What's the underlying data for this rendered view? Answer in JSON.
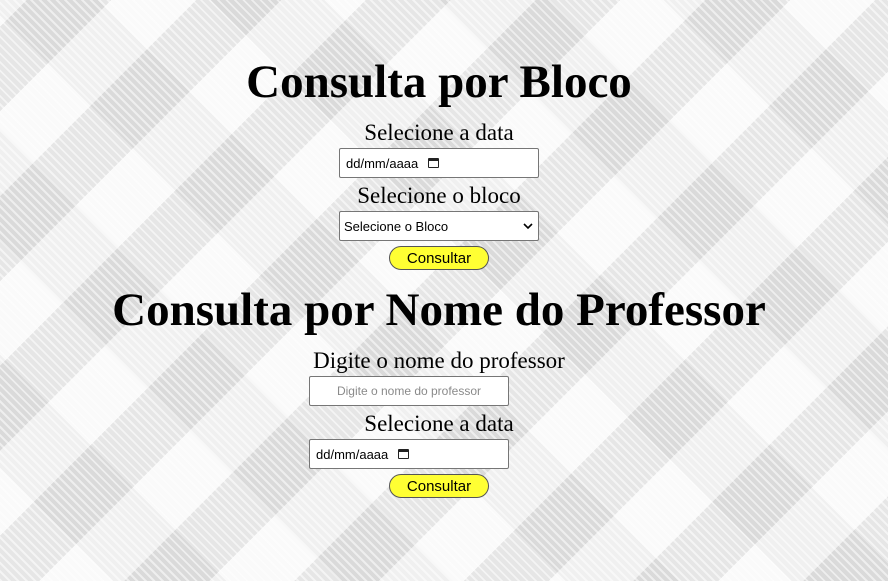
{
  "section_bloco": {
    "title": "Consulta por Bloco",
    "date_label": "Selecione a data",
    "date_value": "dd/mm/aaaa",
    "block_label": "Selecione o bloco",
    "block_selected": "Selecione o Bloco",
    "submit_label": "Consultar"
  },
  "section_professor": {
    "title": "Consulta por Nome do Professor",
    "name_label": "Digite o nome do professor",
    "name_placeholder": "Digite o nome do professor",
    "date_label": "Selecione a data",
    "date_value": "dd/mm/aaaa",
    "submit_label": "Consultar"
  },
  "colors": {
    "button_bg": "#ffff33",
    "text": "#000000"
  },
  "icons": [
    "calendar-icon",
    "chevron-down-icon"
  ]
}
